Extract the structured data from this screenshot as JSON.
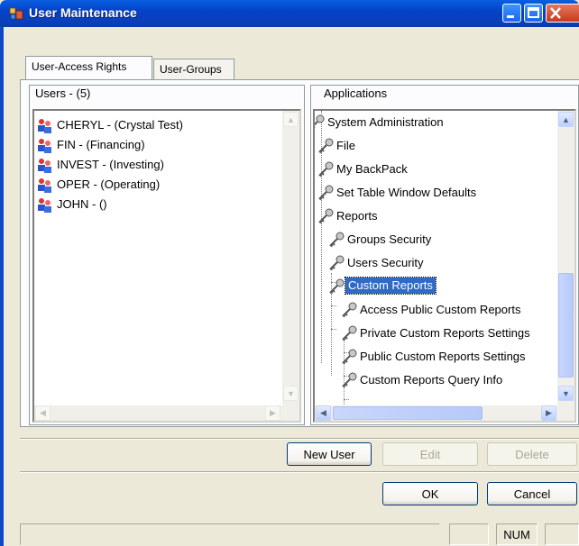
{
  "window": {
    "title": "User Maintenance",
    "colors": {
      "titlebar": "#0a4fd4",
      "selection": "#316ac5",
      "face": "#ece9d8"
    }
  },
  "tabs": [
    {
      "label": "User-Access Rights",
      "active": true
    },
    {
      "label": "User-Groups",
      "active": false
    }
  ],
  "users": {
    "header": "Users - (5)",
    "items": [
      {
        "label": "CHERYL - (Crystal Test)",
        "icon": "user-group-icon"
      },
      {
        "label": "FIN - (Financing)",
        "icon": "user-group-icon"
      },
      {
        "label": "INVEST - (Investing)",
        "icon": "user-group-icon"
      },
      {
        "label": "OPER - (Operating)",
        "icon": "user-group-icon"
      },
      {
        "label": "JOHN - ()",
        "icon": "user-group-icon"
      }
    ]
  },
  "applications": {
    "header": "Applications",
    "items": [
      {
        "label": "System Administration",
        "level": 0,
        "icon": "key-icon"
      },
      {
        "label": "File",
        "level": 0,
        "icon": "key-icon"
      },
      {
        "label": "My BackPack",
        "level": 0,
        "icon": "key-icon"
      },
      {
        "label": "Set Table Window Defaults",
        "level": 0,
        "icon": "key-icon"
      },
      {
        "label": "Reports",
        "level": 0,
        "icon": "key-icon"
      },
      {
        "label": "Groups Security",
        "level": 1,
        "icon": "key-icon"
      },
      {
        "label": "Users Security",
        "level": 1,
        "icon": "key-icon"
      },
      {
        "label": "Custom Reports",
        "level": 1,
        "icon": "key-icon",
        "selected": true
      },
      {
        "label": "Access Public Custom Reports",
        "level": 2,
        "icon": "key-icon"
      },
      {
        "label": "Private Custom Reports Settings",
        "level": 2,
        "icon": "key-icon"
      },
      {
        "label": "Public Custom Reports Settings",
        "level": 2,
        "icon": "key-icon"
      },
      {
        "label": "Custom Reports Query Info",
        "level": 2,
        "icon": "key-icon"
      }
    ]
  },
  "buttons": {
    "new_user": "New User",
    "edit": "Edit",
    "delete": "Delete",
    "ok": "OK",
    "cancel": "Cancel"
  },
  "statusbar": {
    "num": "NUM"
  }
}
